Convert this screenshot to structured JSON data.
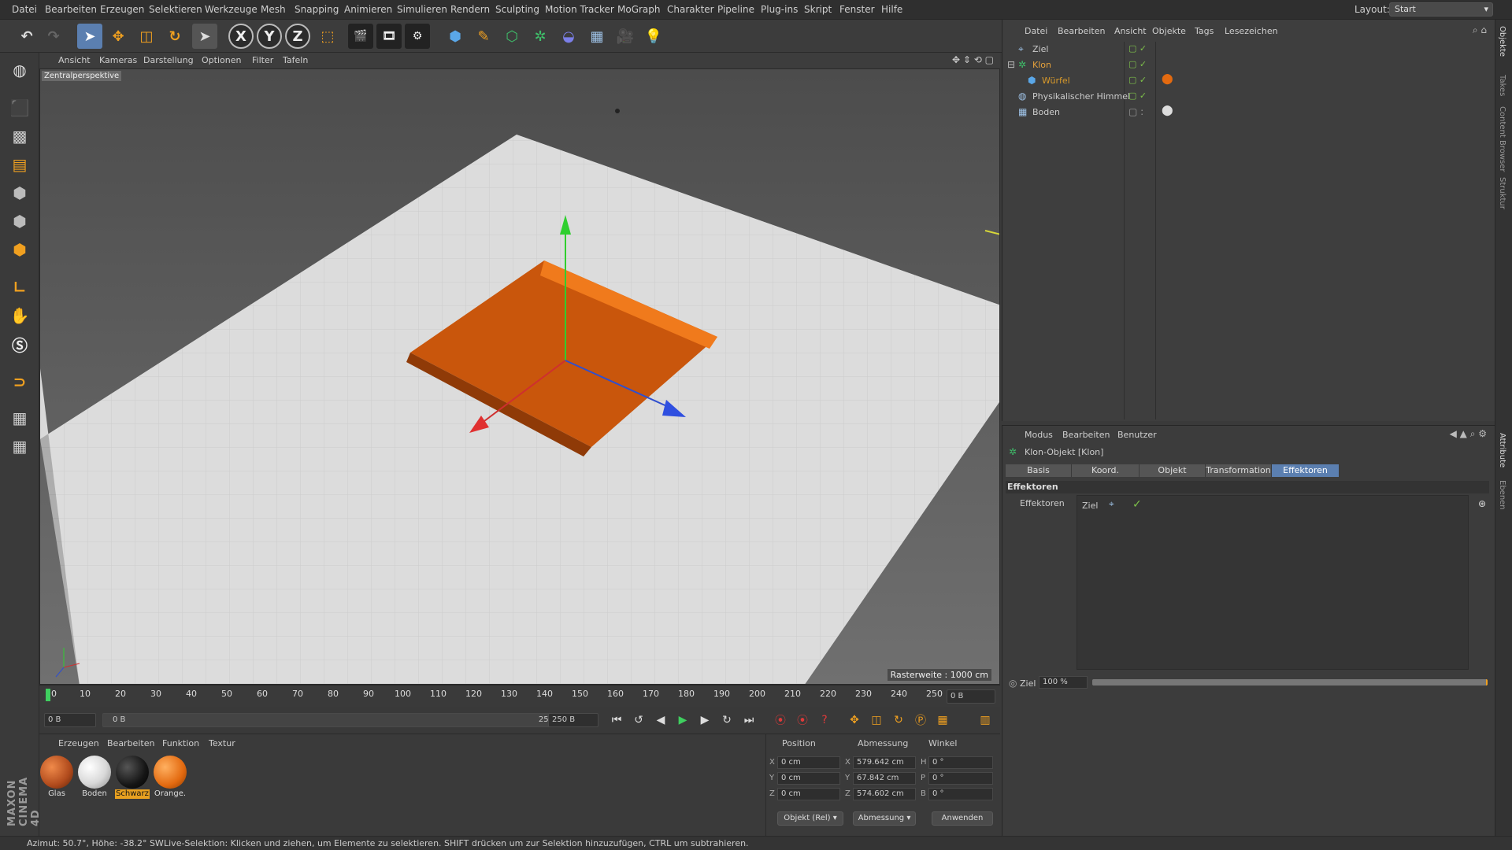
{
  "menubar": {
    "items": [
      "Datei",
      "Bearbeiten",
      "Erzeugen",
      "Selektieren",
      "Werkzeuge",
      "Mesh",
      "Snapping",
      "Animieren",
      "Simulieren",
      "Rendern",
      "Sculpting",
      "Motion Tracker",
      "MoGraph",
      "Charakter",
      "Pipeline",
      "Plug-ins",
      "Skript",
      "Fenster",
      "Hilfe"
    ],
    "layout_label": "Layout:",
    "layout_value": "Start"
  },
  "toolbar": {
    "icons": [
      "undo-icon",
      "redo-icon",
      "select-live-icon",
      "move-icon",
      "scale-icon",
      "rotate-icon",
      "recent-tool-icon",
      "x-axis-icon",
      "y-axis-icon",
      "z-axis-icon",
      "coord-system-icon",
      "render-view-icon",
      "render-picture-viewer-icon",
      "render-settings-icon",
      "cube-primitive-icon",
      "spline-pen-icon",
      "subdivision-icon",
      "cloner-icon",
      "deformer-icon",
      "floor-icon",
      "camera-icon",
      "light-icon"
    ],
    "axis_x": "X",
    "axis_y": "Y",
    "axis_z": "Z"
  },
  "viewport": {
    "menu": [
      "Ansicht",
      "Kameras",
      "Darstellung",
      "Optionen",
      "Filter",
      "Tafeln"
    ],
    "title": "Zentralperspektive",
    "raster": "Rasterweite : 1000 cm"
  },
  "timeline": {
    "ticks": [
      "0",
      "10",
      "20",
      "30",
      "40",
      "50",
      "60",
      "70",
      "80",
      "90",
      "100",
      "110",
      "120",
      "130",
      "140",
      "150",
      "160",
      "170",
      "180",
      "190",
      "200",
      "210",
      "220",
      "230",
      "240",
      "250"
    ],
    "current_frame_field": "0 B",
    "start_field": "0 B",
    "range_start": "0 B",
    "range_end": "250 B",
    "end_field": "250 B"
  },
  "materials": {
    "menu": [
      "Erzeugen",
      "Bearbeiten",
      "Funktion",
      "Textur"
    ],
    "items": [
      {
        "label": "Glas",
        "color": "#b04a1c"
      },
      {
        "label": "Boden",
        "color": "#d8d8d8"
      },
      {
        "label": "Schwarz",
        "color": "#151515"
      },
      {
        "label": "Orange.",
        "color": "#e36a10"
      }
    ]
  },
  "coords": {
    "headers": [
      "Position",
      "Abmessung",
      "Winkel"
    ],
    "rows": [
      {
        "axis": "X",
        "pos": "0 cm",
        "dim": "579.642 cm",
        "rot_label": "H",
        "rot": "0 °"
      },
      {
        "axis": "Y",
        "pos": "0 cm",
        "dim": "67.842 cm",
        "rot_label": "P",
        "rot": "0 °"
      },
      {
        "axis": "Z",
        "pos": "0 cm",
        "dim": "574.602 cm",
        "rot_label": "B",
        "rot": "0 °"
      }
    ],
    "mode_select": "Objekt (Rel)",
    "dim_select": "Abmessung",
    "apply": "Anwenden"
  },
  "objects": {
    "menu": [
      "Datei",
      "Bearbeiten",
      "Ansicht",
      "Objekte",
      "Tags",
      "Lesezeichen"
    ],
    "items": [
      {
        "name": "Ziel",
        "color": "#cccccc",
        "indent": 0
      },
      {
        "name": "Klon",
        "color": "#e6a23c",
        "indent": 0
      },
      {
        "name": "Würfel",
        "color": "#d99a2b",
        "indent": 1
      },
      {
        "name": "Physikalischer Himmel",
        "color": "#cccccc",
        "indent": 0
      },
      {
        "name": "Boden",
        "color": "#cccccc",
        "indent": 0
      }
    ]
  },
  "attributes": {
    "menu": [
      "Modus",
      "Bearbeiten",
      "Benutzer"
    ],
    "object_title": "Klon-Objekt [Klon]",
    "tabs": [
      "Basis",
      "Koord.",
      "Objekt",
      "Transformation",
      "Effektoren"
    ],
    "active_tab": "Effektoren",
    "section": "Effektoren",
    "field_label": "Effektoren",
    "field_item": "Ziel",
    "slider_label": "Ziel",
    "slider_value": "100 %"
  },
  "rightstrip": {
    "tabs": [
      "Objekte",
      "Takes",
      "Content Browser",
      "Struktur",
      "Attribute",
      "Ebenen"
    ]
  },
  "brand": "MAXON CINEMA 4D",
  "status": {
    "coords": "Azimut: 50.7°, Höhe: -38.2°  SW",
    "hint": "Live-Selektion: Klicken und ziehen, um Elemente zu selektieren. SHIFT drücken um zur Selektion hinzuzufügen, CTRL um subtrahieren."
  }
}
